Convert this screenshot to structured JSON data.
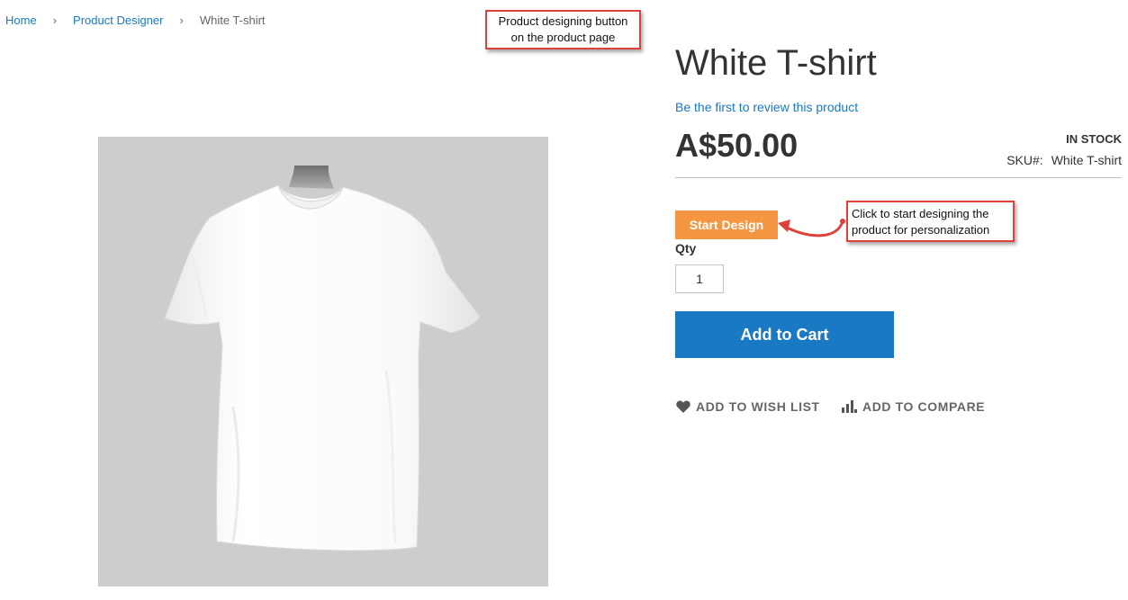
{
  "breadcrumb": {
    "items": [
      "Home",
      "Product Designer"
    ],
    "current": "White T-shirt"
  },
  "annotations": {
    "top_line1": "Product designing button",
    "top_line2": "on the product page",
    "right_line1": "Click to start designing the",
    "right_line2": "product for personalization"
  },
  "product": {
    "title": "White T-shirt",
    "review_link": "Be the first to review this product",
    "price": "A$50.00",
    "stock": "IN STOCK",
    "sku_label": "SKU#:",
    "sku_value": "White T-shirt",
    "start_design_label": "Start Design",
    "qty_label": "Qty",
    "qty_value": "1",
    "add_to_cart_label": "Add to Cart",
    "wishlist_label": "ADD TO WISH LIST",
    "compare_label": "ADD TO COMPARE"
  },
  "colors": {
    "link": "#1979c3",
    "start_design": "#f59742",
    "add_to_cart": "#1979c3",
    "callout_border": "#e0403a",
    "image_bg": "#cdcdcd"
  },
  "icons": {
    "wishlist": "heart-icon",
    "compare": "bar-chart-icon"
  }
}
